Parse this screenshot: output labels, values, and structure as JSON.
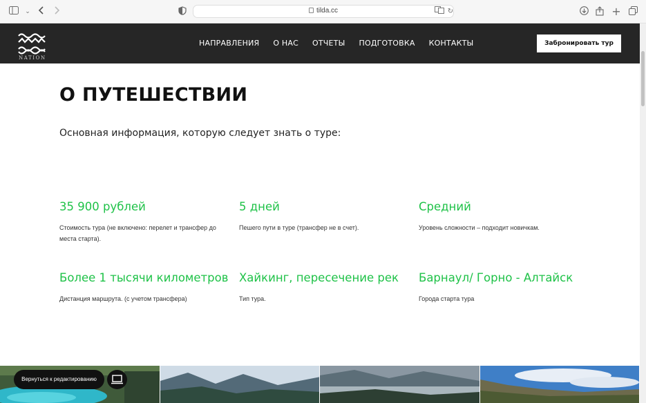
{
  "browser": {
    "url": "tilda.cc",
    "icons": [
      "sidebar-icon",
      "chevron-down-icon",
      "back-icon",
      "forward-icon",
      "shield-icon",
      "translate-icon",
      "reload-icon",
      "download-icon",
      "share-icon",
      "new-tab-icon",
      "tabs-icon"
    ]
  },
  "header": {
    "logo_text": "NATION",
    "nav": [
      {
        "label": "НАПРАВЛЕНИЯ"
      },
      {
        "label": "О НАС"
      },
      {
        "label": "ОТЧЕТЫ"
      },
      {
        "label": "ПОДГОТОВКА"
      },
      {
        "label": "КОНТАКТЫ"
      }
    ],
    "book_label": "Забронировать тур",
    "background": "#262626"
  },
  "main": {
    "title": "О ПУТЕШЕСТВИИ",
    "subtitle": "Основная информация, которую следует знать о туре:",
    "accent_color": "#1fc248",
    "facts": [
      {
        "title": "35 900 рублей",
        "desc": "Стоимость тура (не включено: перелет и трансфер до места старта)."
      },
      {
        "title": "5 дней",
        "desc": "Пешего пути в туре (трансфер не в счет)."
      },
      {
        "title": "Средний",
        "desc": "Уровень сложности – подходит новичкам."
      },
      {
        "title": "Более 1 тысячи километров",
        "desc": "Дистанция маршрута. (с учетом трансфера)"
      },
      {
        "title": "Хайкинг, пересечение рек",
        "desc": "Тип тура."
      },
      {
        "title": "Барнаул/ Горно - Алтайск",
        "desc": "Города старта тура"
      }
    ]
  },
  "editor": {
    "back_label": "Вернуться к редактированию",
    "device_icon": "laptop-icon"
  }
}
